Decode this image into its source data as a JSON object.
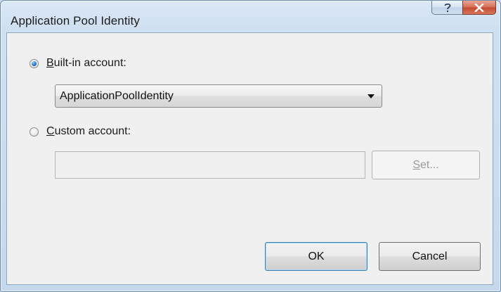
{
  "window": {
    "title": "Application Pool Identity",
    "help_icon": "?",
    "close_icon": "x"
  },
  "builtin": {
    "mnemonic": "B",
    "label_rest": "uilt-in account:",
    "selected": true
  },
  "combo": {
    "value": "ApplicationPoolIdentity"
  },
  "custom": {
    "mnemonic": "C",
    "label_rest": "ustom account:",
    "selected": false,
    "value": ""
  },
  "set_button": {
    "mnemonic": "S",
    "label_rest": "et...",
    "enabled": false
  },
  "ok_button": {
    "label": "OK"
  },
  "cancel_button": {
    "label": "Cancel"
  }
}
